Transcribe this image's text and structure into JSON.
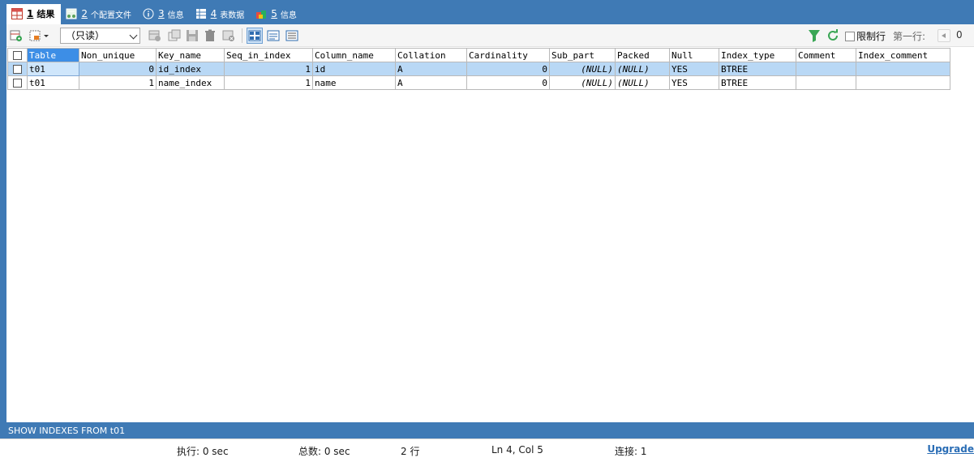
{
  "tabs": [
    {
      "num": "1",
      "label": "结果",
      "icon": "result-grid-icon",
      "active": true
    },
    {
      "num": "2",
      "label": "个配置文件",
      "icon": "profile-icon",
      "active": false
    },
    {
      "num": "3",
      "label": "信息",
      "icon": "info-icon",
      "active": false
    },
    {
      "num": "4",
      "label": "表数据",
      "icon": "table-data-icon",
      "active": false
    },
    {
      "num": "5",
      "label": "信息",
      "icon": "info-history-icon",
      "active": false
    }
  ],
  "toolbar": {
    "mode_select": "（只读）",
    "limit_label": "限制行",
    "first_row_label": "第一行:",
    "first_row_value": "0"
  },
  "grid": {
    "columns": [
      "Table",
      "Non_unique",
      "Key_name",
      "Seq_in_index",
      "Column_name",
      "Collation",
      "Cardinality",
      "Sub_part",
      "Packed",
      "Null",
      "Index_type",
      "Comment",
      "Index_comment"
    ],
    "rows": [
      [
        "t01",
        "0",
        "id_index",
        "1",
        "id",
        "A",
        "0",
        "(NULL)",
        "(NULL)",
        "YES",
        "BTREE",
        "",
        ""
      ],
      [
        "t01",
        "1",
        "name_index",
        "1",
        "name",
        "A",
        "0",
        "(NULL)",
        "(NULL)",
        "YES",
        "BTREE",
        "",
        ""
      ]
    ]
  },
  "query_text": "SHOW INDEXES FROM t01",
  "status": {
    "exec": "执行: 0 sec",
    "total": "总数: 0 sec",
    "rows": "2 行",
    "position": "Ln 4, Col 5",
    "connections": "连接: 1",
    "upgrade": "Upgrade"
  },
  "colors": {
    "frame": "#3f7ab5",
    "selected_row": "#b9d8f5",
    "header_active": "#3d8ee6",
    "upgrade_link": "#2a6db5"
  }
}
